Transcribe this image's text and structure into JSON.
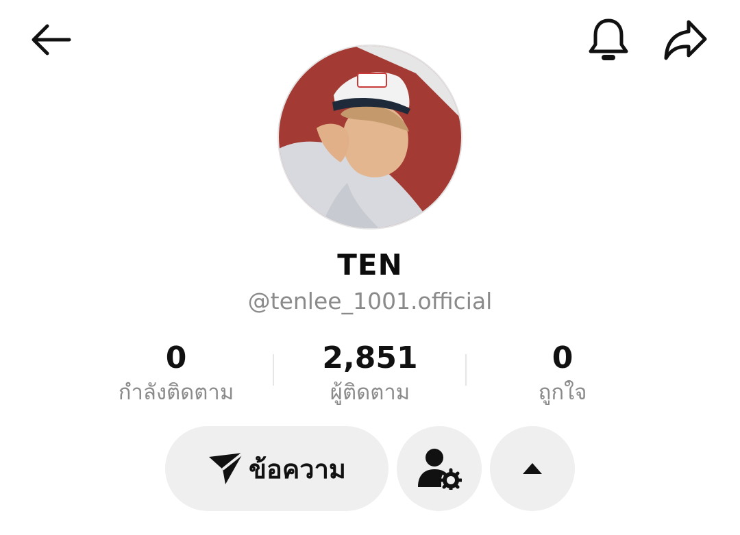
{
  "profile": {
    "name": "TEN",
    "handle": "@tenlee_1001.official",
    "avatar_icon": "profile-photo"
  },
  "stats": {
    "following": {
      "value": "0",
      "label": "กำลังติดตาม"
    },
    "followers": {
      "value": "2,851",
      "label": "ผู้ติดตาม"
    },
    "likes": {
      "value": "0",
      "label": "ถูกใจ"
    }
  },
  "actions": {
    "message_label": "ข้อความ",
    "message_icon": "send-icon",
    "friend_settings_icon": "user-gear-icon",
    "more_icon": "caret-up-icon"
  },
  "topbar": {
    "back_icon": "arrow-left-icon",
    "notify_icon": "bell-icon",
    "share_icon": "share-icon"
  },
  "colors": {
    "button_bg": "#efefef",
    "text_primary": "#111111",
    "text_secondary": "#8a8a8a"
  }
}
